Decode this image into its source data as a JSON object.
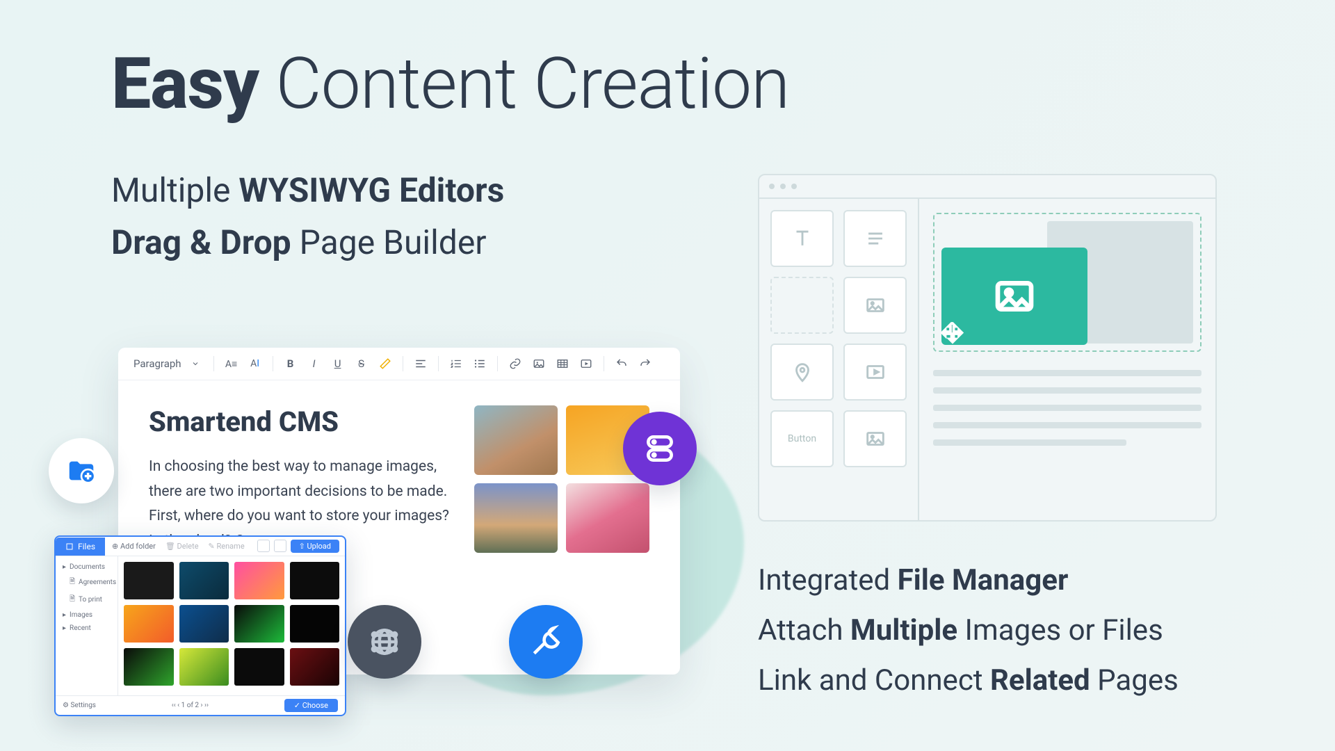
{
  "headline": {
    "bold": "Easy",
    "light": "Content Creation"
  },
  "sub1": {
    "a": "Multiple ",
    "b": "WYSIWYG Editors"
  },
  "sub2": {
    "a": "Drag & Drop ",
    "b": "Page Builder"
  },
  "toolbar": {
    "paragraph": "Paragraph"
  },
  "editor": {
    "title": "Smartend CMS",
    "body": "In choosing the best way to manage images, there are two important decisions to be made. First, where do you want to store your images? In the cloud? On your"
  },
  "fm": {
    "tab": "Files",
    "addfolder": "Add folder",
    "delete": "Delete",
    "rename": "Rename",
    "upload": "Upload",
    "side": {
      "documents": "Documents",
      "agreements": "Agreements",
      "toprint": "To print",
      "images": "Images",
      "recent": "Recent"
    },
    "foot": {
      "settings": "Settings",
      "pages": "1 of 2",
      "choose": "Choose"
    }
  },
  "pb": {
    "button": "Button"
  },
  "features": {
    "f1a": "Integrated ",
    "f1b": "File Manager",
    "f2a": "Attach ",
    "f2b": "Multiple",
    "f2c": " Images or Files",
    "f3a": "Link and Connect ",
    "f3b": "Related",
    "f3c": " Pages"
  }
}
